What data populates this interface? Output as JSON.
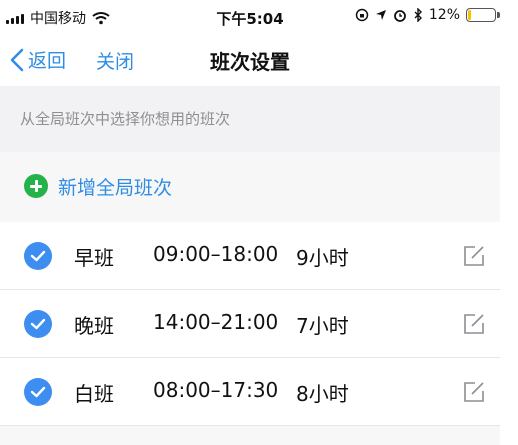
{
  "status_bar": {
    "carrier": "中国移动",
    "time": "下午5:04",
    "battery_percent": "12%",
    "battery_level": 0.12,
    "battery_color": "#f5c400"
  },
  "nav": {
    "back_label": "返回",
    "close_label": "关闭",
    "title": "班次设置"
  },
  "hint": "从全局班次中选择你想用的班次",
  "add_button": {
    "label": "新增全局班次",
    "icon": "plus-circle-icon",
    "color": "#24b24a"
  },
  "shifts": [
    {
      "name": "早班",
      "time": "09:00–18:00",
      "duration": "9小时",
      "selected": true
    },
    {
      "name": "晚班",
      "time": "14:00–21:00",
      "duration": "7小时",
      "selected": true
    },
    {
      "name": "白班",
      "time": "08:00–17:30",
      "duration": "8小时",
      "selected": true
    }
  ],
  "colors": {
    "accent": "#2f8de4",
    "check": "#3d8ef0"
  }
}
